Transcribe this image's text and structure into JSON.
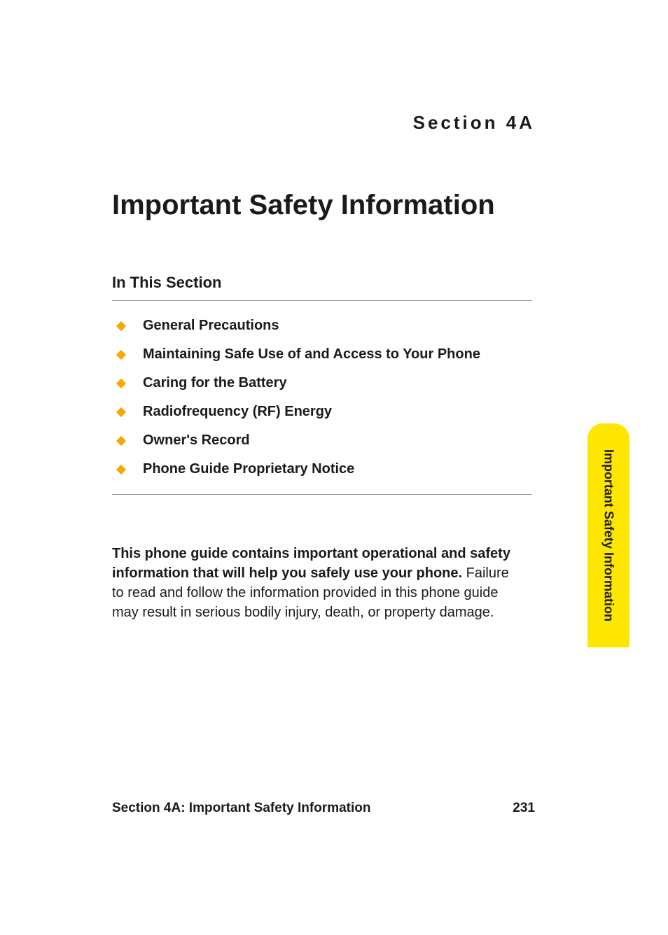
{
  "section_label": "Section 4A",
  "main_title": "Important Safety Information",
  "sub_heading": "In This Section",
  "toc_items": [
    "General Precautions",
    "Maintaining Safe Use of and Access to Your Phone",
    "Caring for the Battery",
    "Radiofrequency (RF) Energy",
    "Owner's Record",
    "Phone Guide Proprietary Notice"
  ],
  "body_bold": "This phone guide contains important operational and safety information that will help you safely use your phone.",
  "body_rest": " Failure to read and follow the information provided in this phone guide may result in serious bodily injury, death, or property damage.",
  "side_tab": "Important Safety Information",
  "footer_text": "Section 4A: Important Safety Information",
  "page_number": "231"
}
